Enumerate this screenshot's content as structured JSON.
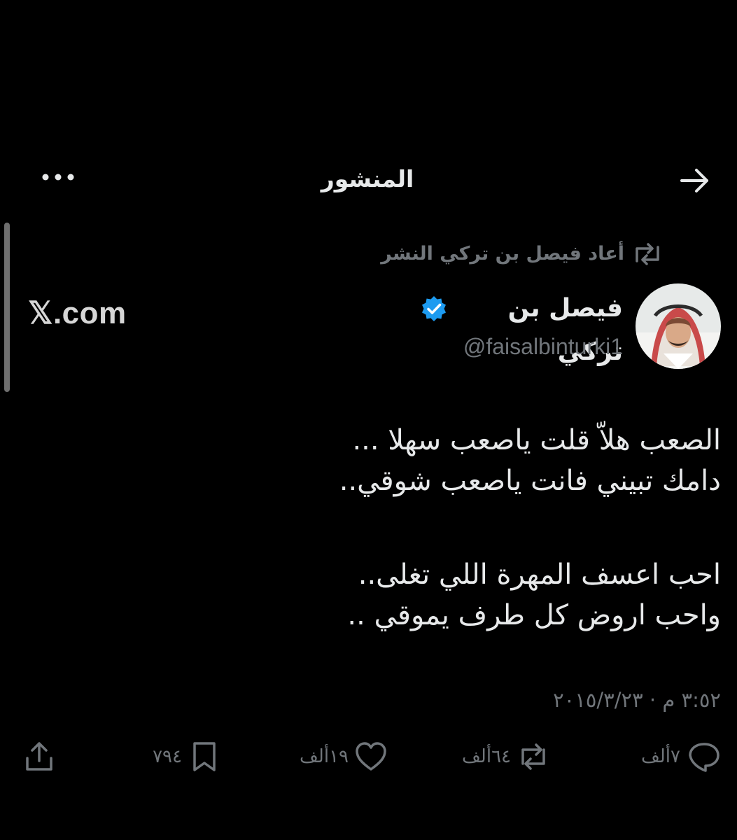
{
  "header": {
    "title": "المنشور",
    "back_icon": "arrow-right-icon",
    "more_icon": "more-horizontal-icon"
  },
  "overlay": {
    "site_label": "𝕏.com"
  },
  "tweet": {
    "repost_text": "أعاد فيصل بن تركي النشر",
    "author_name": "فيصل بن تركي",
    "handle": "@faisalbinturki1",
    "verified": true,
    "lines": [
      "الصعب هلاّ قلت ياصعب سهلا ...",
      "دامك تبيني فانت ياصعب شوقي..",
      "احب اعسف المهرة اللي تغلى..",
      "واحب اروض كل طرف يموقي .."
    ],
    "timestamp": "٣:٥٢ م · ٢٠١٥/٣/٢٣"
  },
  "actions": {
    "replies": "٧ألف",
    "reposts": "٦٤ألف",
    "likes": "١٩ألف",
    "bookmarks": "٧٩٤"
  },
  "colors": {
    "background": "#000000",
    "text": "#e7e9ea",
    "muted": "#71767b",
    "verified": "#1d9bf0"
  }
}
